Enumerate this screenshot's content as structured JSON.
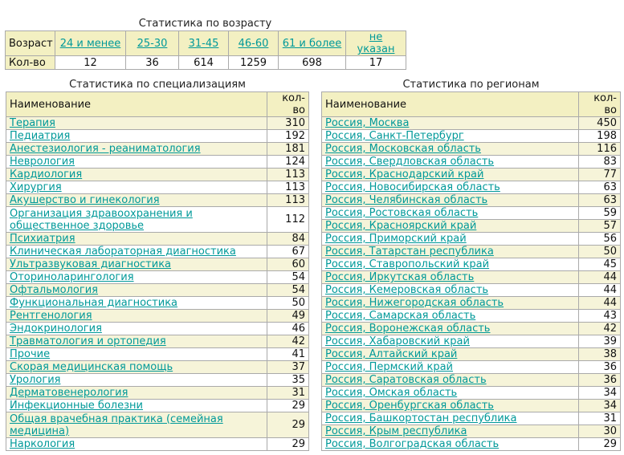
{
  "age_stats": {
    "caption": "Статистика по возрасту",
    "row1_label": "Возраст",
    "row2_label": "Кол-во",
    "groups": [
      {
        "label": "24 и менее",
        "count": "12"
      },
      {
        "label": "25-30",
        "count": "36"
      },
      {
        "label": "31-45",
        "count": "614"
      },
      {
        "label": "46-60",
        "count": "1259"
      },
      {
        "label": "61 и более",
        "count": "698"
      },
      {
        "label": "не указан",
        "count": "17"
      }
    ]
  },
  "specialization_stats": {
    "caption": "Статистика по специализациям",
    "col_name": "Наименование",
    "col_count": "кол-во",
    "rows": [
      {
        "name": "Терапия",
        "count": "310"
      },
      {
        "name": "Педиатрия",
        "count": "192"
      },
      {
        "name": "Анестезиология - реаниматология",
        "count": "181"
      },
      {
        "name": "Неврология",
        "count": "124"
      },
      {
        "name": "Кардиология",
        "count": "113"
      },
      {
        "name": "Хирургия",
        "count": "113"
      },
      {
        "name": "Акушерство и гинекология",
        "count": "113"
      },
      {
        "name": "Организация здравоохранения и общественное здоровье",
        "count": "112"
      },
      {
        "name": "Психиатрия",
        "count": "84"
      },
      {
        "name": "Клиническая лабораторная диагностика",
        "count": "67"
      },
      {
        "name": "Ультразвуковая диагностика",
        "count": "60"
      },
      {
        "name": "Оториноларингология",
        "count": "54"
      },
      {
        "name": "Офтальмология",
        "count": "54"
      },
      {
        "name": "Функциональная диагностика",
        "count": "50"
      },
      {
        "name": "Рентгенология",
        "count": "49"
      },
      {
        "name": "Эндокринология",
        "count": "46"
      },
      {
        "name": "Травматология и ортопедия",
        "count": "42"
      },
      {
        "name": "Прочие",
        "count": "41"
      },
      {
        "name": "Скорая медицинская помощь",
        "count": "37"
      },
      {
        "name": "Урология",
        "count": "35"
      },
      {
        "name": "Дерматовенерология",
        "count": "31"
      },
      {
        "name": "Инфекционные болезни",
        "count": "29"
      },
      {
        "name": "Общая врачебная практика (семейная медицина)",
        "count": "29"
      },
      {
        "name": "Наркология",
        "count": "29"
      }
    ]
  },
  "region_stats": {
    "caption": "Статистика по регионам",
    "col_name": "Наименование",
    "col_count": "кол-во",
    "rows": [
      {
        "name": "Россия, Москва",
        "count": "450"
      },
      {
        "name": "Россия, Санкт-Петербург",
        "count": "198"
      },
      {
        "name": "Россия, Московская область",
        "count": "116"
      },
      {
        "name": "Россия, Свердловская область",
        "count": "83"
      },
      {
        "name": "Россия, Краснодарский край",
        "count": "77"
      },
      {
        "name": "Россия, Новосибирская область",
        "count": "63"
      },
      {
        "name": "Россия, Челябинская область",
        "count": "63"
      },
      {
        "name": "Россия, Ростовская область",
        "count": "59"
      },
      {
        "name": "Россия, Красноярский край",
        "count": "57"
      },
      {
        "name": "Россия, Приморский край",
        "count": "56"
      },
      {
        "name": "Россия, Татарстан республика",
        "count": "50"
      },
      {
        "name": "Россия, Ставропольский край",
        "count": "45"
      },
      {
        "name": "Россия, Иркутская область",
        "count": "44"
      },
      {
        "name": "Россия, Кемеровская область",
        "count": "44"
      },
      {
        "name": "Россия, Нижегородская область",
        "count": "44"
      },
      {
        "name": "Россия, Самарская область",
        "count": "43"
      },
      {
        "name": "Россия, Воронежская область",
        "count": "42"
      },
      {
        "name": "Россия, Хабаровский край",
        "count": "39"
      },
      {
        "name": "Россия, Алтайский край",
        "count": "38"
      },
      {
        "name": "Россия, Пермский край",
        "count": "36"
      },
      {
        "name": "Россия, Саратовская область",
        "count": "36"
      },
      {
        "name": "Россия, Омская область",
        "count": "34"
      },
      {
        "name": "Россия, Оренбургская область",
        "count": "34"
      },
      {
        "name": "Россия, Башкортостан республика",
        "count": "31"
      },
      {
        "name": "Россия, Крым республика",
        "count": "30"
      },
      {
        "name": "Россия, Волгоградская область",
        "count": "29"
      }
    ]
  }
}
